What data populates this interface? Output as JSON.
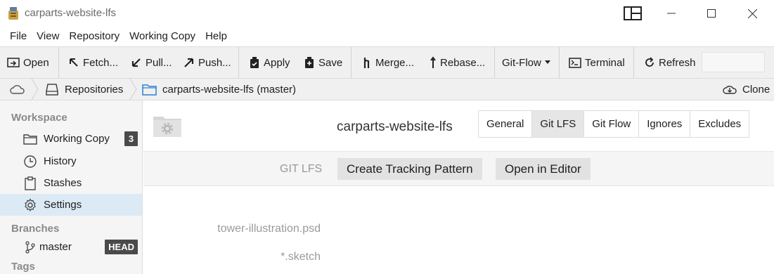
{
  "window": {
    "title": "carparts-website-lfs"
  },
  "menu": [
    "File",
    "View",
    "Repository",
    "Working Copy",
    "Help"
  ],
  "toolbar": {
    "open": "Open",
    "fetch": "Fetch...",
    "pull": "Pull...",
    "push": "Push...",
    "apply": "Apply",
    "save": "Save",
    "merge": "Merge...",
    "rebase": "Rebase...",
    "gitflow": "Git-Flow",
    "terminal": "Terminal",
    "refresh": "Refresh"
  },
  "breadcrumb": {
    "repositories": "Repositories",
    "repo": "carparts-website-lfs (master)",
    "clone": "Clone"
  },
  "sidebar": {
    "workspace_heading": "Workspace",
    "items": [
      {
        "label": "Working Copy",
        "badge": "3",
        "icon": "folder-icon"
      },
      {
        "label": "History",
        "icon": "clock-icon"
      },
      {
        "label": "Stashes",
        "icon": "clipboard-icon"
      },
      {
        "label": "Settings",
        "icon": "gear-icon",
        "selected": true
      }
    ],
    "branches_heading": "Branches",
    "branch": {
      "label": "master",
      "badge": "HEAD",
      "icon": "branch-icon"
    },
    "tags_heading": "Tags"
  },
  "main": {
    "repo_name": "carparts-website-lfs",
    "tabs": [
      {
        "label": "General"
      },
      {
        "label": "Git LFS",
        "active": true
      },
      {
        "label": "Git Flow"
      },
      {
        "label": "Ignores"
      },
      {
        "label": "Excludes"
      }
    ],
    "lfs": {
      "label": "GIT LFS",
      "create_button": "Create Tracking Pattern",
      "open_button": "Open in Editor"
    },
    "patterns": [
      "tower-illustration.psd",
      "*.sketch"
    ]
  },
  "colors": {
    "selection": "#dceaf5",
    "badge": "#4a4a4a",
    "toolbar_bg": "#f0f0f0",
    "folder_blue": "#2a7fd4"
  }
}
